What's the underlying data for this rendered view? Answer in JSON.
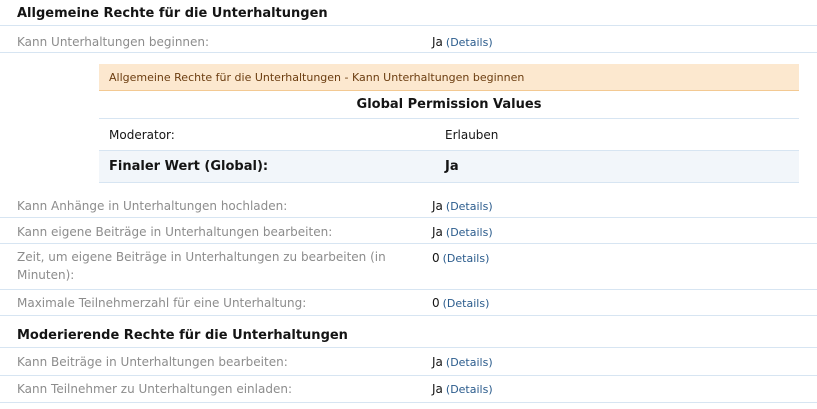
{
  "sections": [
    {
      "title": "Allgemeine Rechte für die Unterhaltungen"
    },
    {
      "title": "Moderierende Rechte für die Unterhaltungen"
    }
  ],
  "rows": [
    {
      "label": "Kann Unterhaltungen beginnen:",
      "value": "Ja",
      "details": "(Details)"
    },
    {
      "label": "Kann Anhänge in Unterhaltungen hochladen:",
      "value": "Ja",
      "details": "(Details)"
    },
    {
      "label": "Kann eigene Beiträge in Unterhaltungen bearbeiten:",
      "value": "Ja",
      "details": "(Details)"
    },
    {
      "label": "Zeit, um eigene Beiträge in Unterhaltungen zu bearbeiten (in Minuten):",
      "value": "0",
      "details": "(Details)"
    },
    {
      "label": "Maximale Teilnehmerzahl für eine Unterhaltung:",
      "value": "0",
      "details": "(Details)"
    },
    {
      "label": "Kann Beiträge in Unterhaltungen bearbeiten:",
      "value": "Ja",
      "details": "(Details)"
    },
    {
      "label": "Kann Teilnehmer zu Unterhaltungen einladen:",
      "value": "Ja",
      "details": "(Details)"
    }
  ],
  "detail_panel": {
    "title": "Allgemeine Rechte für die Unterhaltungen - Kann Unterhaltungen beginnen",
    "heading": "Global Permission Values",
    "moderator_label": "Moderator:",
    "moderator_value": "Erlauben",
    "final_label": "Finaler Wert (Global):",
    "final_value": "Ja"
  }
}
